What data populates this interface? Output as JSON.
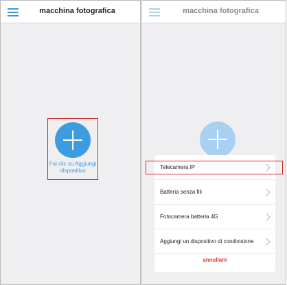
{
  "left_screen": {
    "title": "macchina fotografica",
    "add_label": "Fai clic su Aggiungi dispositivo"
  },
  "right_screen": {
    "title": "macchina fotografica",
    "sheet": {
      "items": [
        {
          "label": "Telecamera IP"
        },
        {
          "label": "Batteria senza fili"
        },
        {
          "label": "Fotocamera batteria 4G"
        },
        {
          "label": "Aggiungi un dispositivo di condivisione"
        }
      ],
      "cancel_label": "annullare"
    }
  },
  "icons": [
    "menu-icon",
    "plus-icon",
    "chevron-right-icon"
  ],
  "colors": {
    "accent": "#3d9be0",
    "highlight": "#d2232a",
    "cancel": "#e4352f"
  }
}
